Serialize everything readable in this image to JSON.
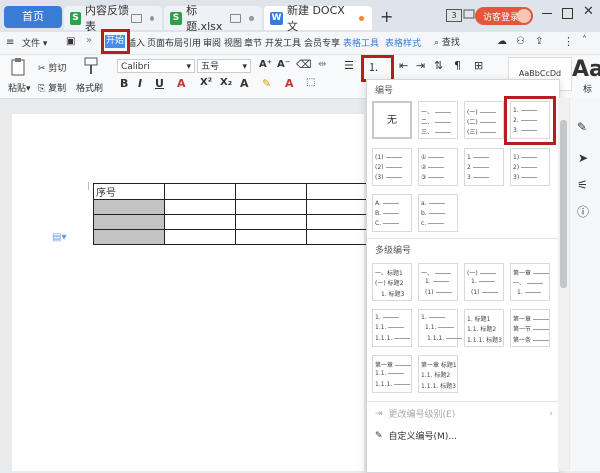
{
  "tabs": {
    "home": "首页",
    "items": [
      {
        "label": "内容反馈表",
        "icon": "S",
        "icon_color": "#2ea043"
      },
      {
        "label": "标题.xlsx",
        "icon": "S",
        "icon_color": "#2ea043"
      },
      {
        "label": "新建 DOCX 文",
        "icon": "W",
        "icon_color": "#3a7bd5"
      }
    ],
    "page_count": "3",
    "login": "访客登录"
  },
  "menu": {
    "file": "文件",
    "items": [
      "开始",
      "插入",
      "页面布局",
      "引用",
      "审阅",
      "视图",
      "章节",
      "开发工具",
      "会员专享",
      "表格工具",
      "表格样式"
    ],
    "search": "查找"
  },
  "ribbon": {
    "paste": "粘贴",
    "cut": "剪切",
    "copy": "复制",
    "format_painter": "格式刷",
    "font_name": "Calibri",
    "font_size": "五号",
    "style_preview": "AaBbCcDd",
    "style_preview2": "Aa",
    "style_label": "标"
  },
  "table": {
    "header": "序号"
  },
  "numbering_panel": {
    "section1": "编号",
    "none_label": "无",
    "section2": "多级编号",
    "change_level": "更改编号级别(E)",
    "custom": "自定义编号(M)..."
  },
  "accent_color": "#3a7bd5",
  "highlight_color": "#b31e1e"
}
